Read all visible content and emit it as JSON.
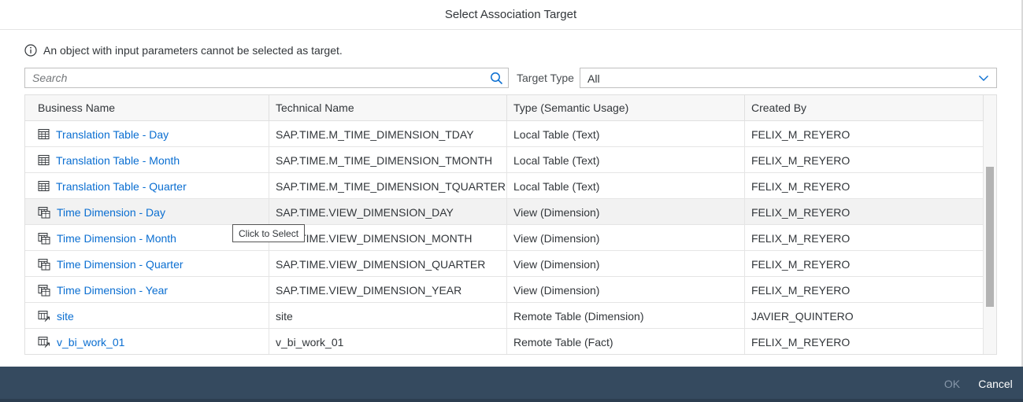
{
  "dialog": {
    "title": "Select Association Target",
    "info_message": "An object with input parameters cannot be selected as target.",
    "info_icon": "info-icon"
  },
  "filters": {
    "search_placeholder": "Search",
    "search_icon": "search-icon",
    "target_type_label": "Target Type",
    "target_type_value": "All"
  },
  "table": {
    "columns": [
      "Business Name",
      "Technical Name",
      "Type (Semantic Usage)",
      "Created By"
    ],
    "rows": [
      {
        "business_name": "Translation Table - Day",
        "technical_name": "SAP.TIME.M_TIME_DIMENSION_TDAY",
        "type": "Local Table (Text)",
        "created_by": "FELIX_M_REYERO",
        "icon": "table-icon"
      },
      {
        "business_name": "Translation Table - Month",
        "technical_name": "SAP.TIME.M_TIME_DIMENSION_TMONTH",
        "type": "Local Table (Text)",
        "created_by": "FELIX_M_REYERO",
        "icon": "table-icon"
      },
      {
        "business_name": "Translation Table - Quarter",
        "technical_name": "SAP.TIME.M_TIME_DIMENSION_TQUARTER",
        "type": "Local Table (Text)",
        "created_by": "FELIX_M_REYERO",
        "icon": "table-icon"
      },
      {
        "business_name": "Time Dimension - Day",
        "technical_name": "SAP.TIME.VIEW_DIMENSION_DAY",
        "type": "View (Dimension)",
        "created_by": "FELIX_M_REYERO",
        "icon": "view-icon"
      },
      {
        "business_name": "Time Dimension - Month",
        "technical_name": "SAP.TIME.VIEW_DIMENSION_MONTH",
        "type": "View (Dimension)",
        "created_by": "FELIX_M_REYERO",
        "icon": "view-icon"
      },
      {
        "business_name": "Time Dimension - Quarter",
        "technical_name": "SAP.TIME.VIEW_DIMENSION_QUARTER",
        "type": "View (Dimension)",
        "created_by": "FELIX_M_REYERO",
        "icon": "view-icon"
      },
      {
        "business_name": "Time Dimension - Year",
        "technical_name": "SAP.TIME.VIEW_DIMENSION_YEAR",
        "type": "View (Dimension)",
        "created_by": "FELIX_M_REYERO",
        "icon": "view-icon"
      },
      {
        "business_name": "site",
        "technical_name": "site",
        "type": "Remote Table (Dimension)",
        "created_by": "JAVIER_QUINTERO",
        "icon": "remote-table-icon"
      },
      {
        "business_name": "v_bi_work_01",
        "technical_name": "v_bi_work_01",
        "type": "Remote Table (Fact)",
        "created_by": "FELIX_M_REYERO",
        "icon": "remote-table-icon"
      }
    ]
  },
  "tooltip": {
    "text": "Click to Select"
  },
  "footer": {
    "ok_label": "OK",
    "cancel_label": "Cancel"
  },
  "colors": {
    "link": "#0a6ed1",
    "footer_bg": "#354a5f",
    "highlight_row": "#f2f2f2"
  }
}
